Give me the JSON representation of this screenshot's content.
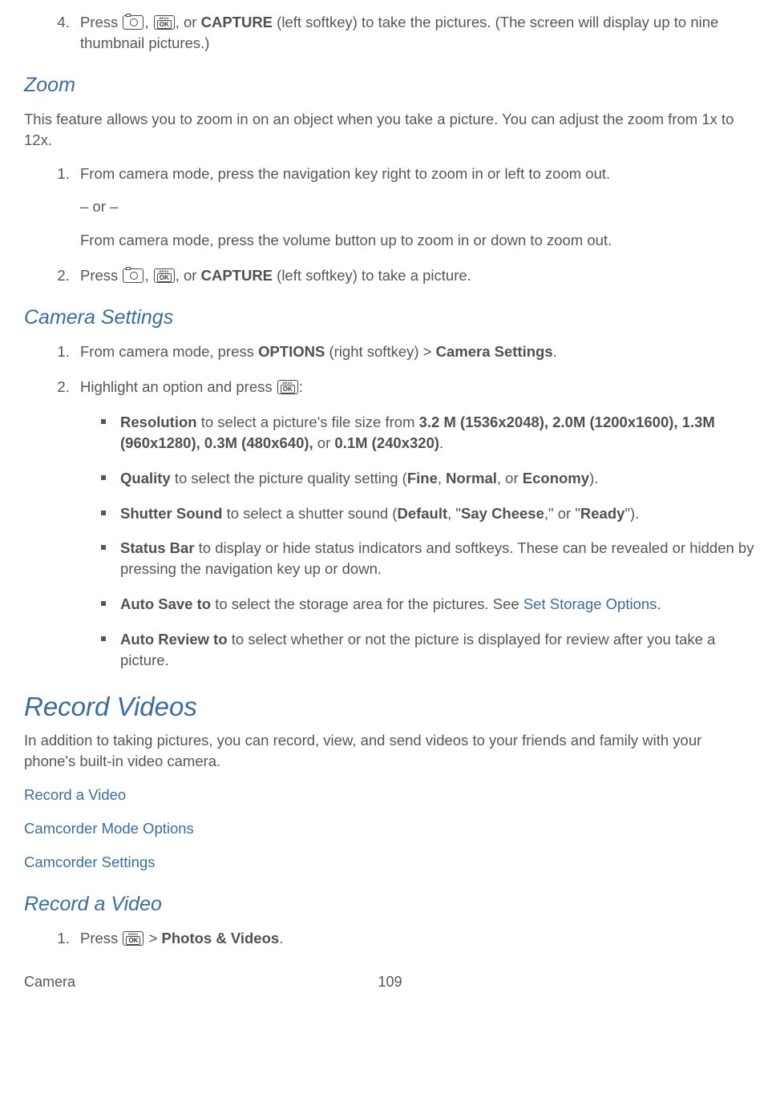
{
  "step4": {
    "num": "4.",
    "t1": "Press ",
    "t2": ", ",
    "t3": ", or ",
    "b1": "CAPTURE",
    "t4": " (left softkey) to take the pictures. (The screen will display up to nine thumbnail pictures.)"
  },
  "zoom": {
    "heading": "Zoom",
    "intro": "This feature allows you to zoom in on an object when you take a picture. You can adjust the zoom from 1x to 12x.",
    "s1": {
      "l1": "From camera mode, press the navigation key right to zoom in or left to zoom out.",
      "or": "– or –",
      "l2": "From camera mode, press the volume button up to zoom in or down to zoom out."
    },
    "s2": {
      "t1": "Press ",
      "t2": ", ",
      "t3": ", or ",
      "b1": "CAPTURE",
      "t4": " (left softkey) to take a picture."
    }
  },
  "cset": {
    "heading": "Camera Settings",
    "s1": {
      "t1": "From camera mode, press ",
      "b1": "OPTIONS",
      "t2": " (right softkey) > ",
      "b2": "Camera Settings",
      "t3": "."
    },
    "s2": {
      "t1": "Highlight an option and press ",
      "t2": ":"
    },
    "opts": {
      "res": {
        "b1": "Resolution",
        "t1": " to select a picture's file size from ",
        "b2": "3.2 M (1536x2048), 2.0M (1200x1600), 1.3M (960x1280), 0.3M (480x640),",
        "t2": " or ",
        "b3": "0.1M (240x320)",
        "t3": "."
      },
      "qual": {
        "b1": "Quality",
        "t1": " to select the picture quality setting (",
        "b2": "Fine",
        "t2": ", ",
        "b3": "Normal",
        "t3": ", or ",
        "b4": "Economy",
        "t4": ")."
      },
      "shut": {
        "b1": "Shutter Sound",
        "t1": " to select a shutter sound (",
        "b2": "Default",
        "t2": ", \"",
        "b3": "Say Cheese",
        "t3": ",\" or \"",
        "b4": "Ready",
        "t4": "\")."
      },
      "stat": {
        "b1": "Status Bar",
        "t1": " to display or hide status indicators and softkeys. These can be revealed or hidden by pressing the navigation key up or down."
      },
      "save": {
        "b1": "Auto Save to",
        "t1": " to select the storage area for the pictures. See ",
        "link": "Set Storage Options",
        "t2": "."
      },
      "rev": {
        "b1": "Auto Review to",
        "t1": " to select whether or not the picture is displayed for review after you take a picture."
      }
    }
  },
  "rv": {
    "heading": "Record Videos",
    "intro": "In addition to taking pictures, you can record, view, and send videos to your friends and family with your phone's built-in video camera.",
    "links": {
      "a": "Record a Video",
      "b": "Camcorder Mode Options",
      "c": "Camcorder Settings"
    },
    "sub_heading": "Record a Video",
    "s1": {
      "t1": "Press ",
      "t2": " > ",
      "b1": "Photos & Videos",
      "t3": "."
    }
  },
  "footer": {
    "section": "Camera",
    "page": "109"
  }
}
